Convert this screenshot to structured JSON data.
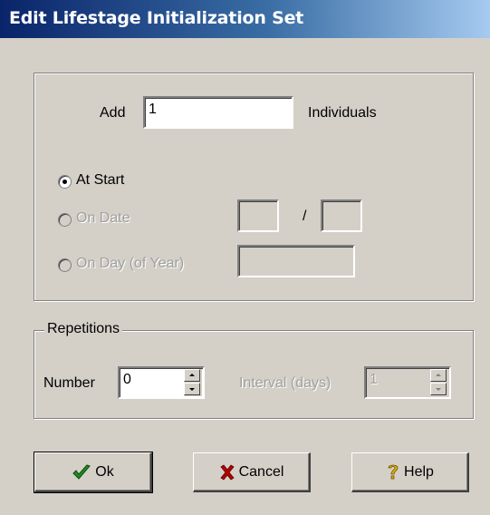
{
  "window": {
    "title": "Edit Lifestage Initialization Set"
  },
  "add": {
    "label": "Add",
    "value": "1",
    "suffix": "Individuals"
  },
  "timing": {
    "at_start_label": "At Start",
    "on_date_label": "On Date",
    "date_separator": "/",
    "on_day_label": "On Day (of Year)",
    "selected": "at_start"
  },
  "repetitions": {
    "legend": "Repetitions",
    "number_label": "Number",
    "number_value": "0",
    "interval_label": "Interval (days)",
    "interval_value": "1"
  },
  "buttons": {
    "ok": "Ok",
    "cancel": "Cancel",
    "help": "Help"
  },
  "icons": {
    "ok": "checkmark-icon",
    "cancel": "x-icon",
    "help": "question-mark-icon"
  },
  "colors": {
    "titlebar_start": "#0a246a",
    "titlebar_end": "#a6caf0",
    "dialog_bg": "#d4d0c8",
    "ok_icon": "#1f8a1f",
    "cancel_icon": "#b40000",
    "help_icon": "#d4a300"
  }
}
